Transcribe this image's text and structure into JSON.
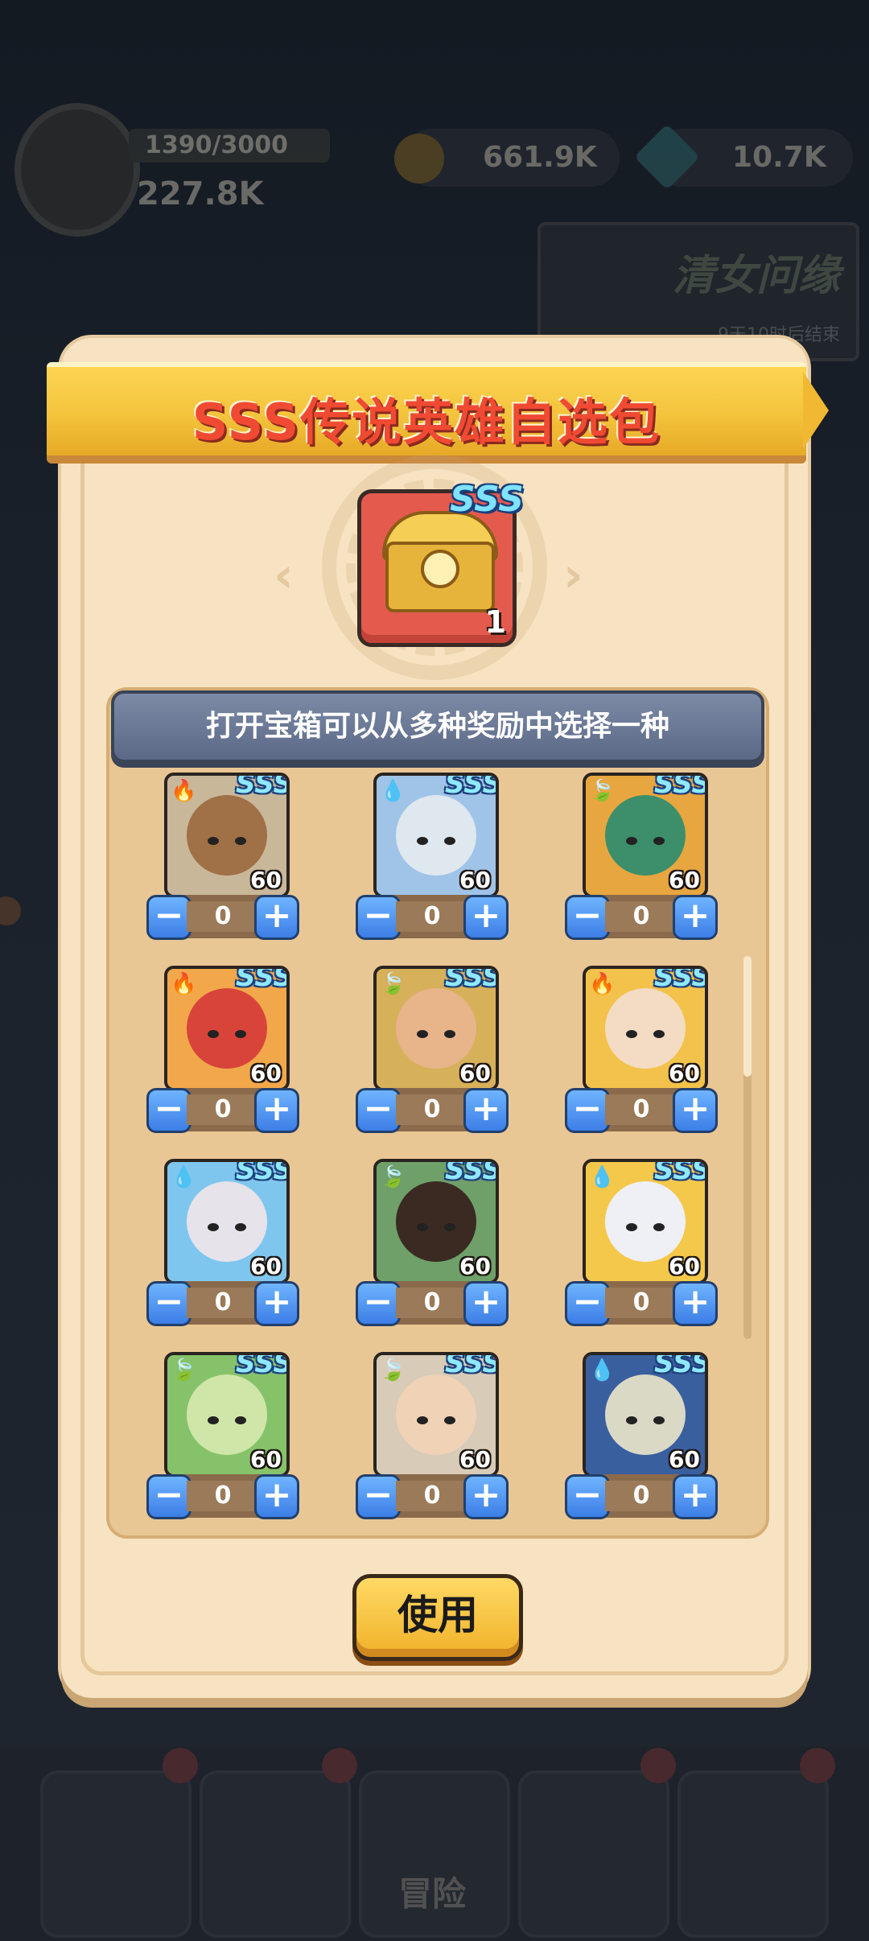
{
  "hud": {
    "level_progress": "1390/3000",
    "power": "227.8K",
    "gold": "661.9K",
    "gems": "10.7K",
    "event_title": "清女问缘",
    "event_subtitle": "9天10时后结束",
    "nav_center_label": "冒险"
  },
  "modal": {
    "title": "SSS传说英雄自选包",
    "chest_grade": "SSS",
    "chest_count": "1",
    "info_text": "打开宝箱可以从多种奖励中选择一种",
    "use_button": "使用"
  },
  "heroes": [
    {
      "element": "fire",
      "element_icon": "🔥",
      "grade": "SSS",
      "level": "60",
      "qty": "0",
      "colors": {
        "bg": "#c9b79a",
        "face": "#a07046"
      }
    },
    {
      "element": "water",
      "element_icon": "💧",
      "grade": "SSS",
      "level": "60",
      "qty": "0",
      "colors": {
        "bg": "#9fc4e8",
        "face": "#dfe7ef"
      }
    },
    {
      "element": "nature",
      "element_icon": "🍃",
      "grade": "SSS",
      "level": "60",
      "qty": "0",
      "colors": {
        "bg": "#e8a640",
        "face": "#3c8f6a"
      }
    },
    {
      "element": "fire",
      "element_icon": "🔥",
      "grade": "SSS",
      "level": "60",
      "qty": "0",
      "colors": {
        "bg": "#f2a84a",
        "face": "#d8443a"
      }
    },
    {
      "element": "nature",
      "element_icon": "🍃",
      "grade": "SSS",
      "level": "60",
      "qty": "0",
      "colors": {
        "bg": "#d7b05a",
        "face": "#e8b48a"
      }
    },
    {
      "element": "fire",
      "element_icon": "🔥",
      "grade": "SSS",
      "level": "60",
      "qty": "0",
      "colors": {
        "bg": "#f2c24a",
        "face": "#f3dcc3"
      }
    },
    {
      "element": "water",
      "element_icon": "💧",
      "grade": "SSS",
      "level": "60",
      "qty": "0",
      "colors": {
        "bg": "#7fc6ee",
        "face": "#e6e3ea"
      }
    },
    {
      "element": "nature",
      "element_icon": "🍃",
      "grade": "SSS",
      "level": "60",
      "qty": "0",
      "colors": {
        "bg": "#6fa06a",
        "face": "#3a2a22"
      }
    },
    {
      "element": "water",
      "element_icon": "💧",
      "grade": "SSS",
      "level": "60",
      "qty": "0",
      "colors": {
        "bg": "#f4c84a",
        "face": "#eef0f6"
      }
    },
    {
      "element": "nature",
      "element_icon": "🍃",
      "grade": "SSS",
      "level": "60",
      "qty": "0",
      "colors": {
        "bg": "#86c26a",
        "face": "#cfe6a8"
      }
    },
    {
      "element": "nature",
      "element_icon": "🍃",
      "grade": "SSS",
      "level": "60",
      "qty": "0",
      "colors": {
        "bg": "#d8cbb8",
        "face": "#f0d2b6"
      }
    },
    {
      "element": "water",
      "element_icon": "💧",
      "grade": "SSS",
      "level": "60",
      "qty": "0",
      "colors": {
        "bg": "#3a5f9e",
        "face": "#d9d9c6"
      }
    }
  ],
  "stepper": {
    "minus": "−",
    "plus": "+"
  },
  "colors": {
    "accent_blue": "#3c7ee6",
    "title_red": "#f04a33",
    "button_gold": "#f0b128"
  }
}
